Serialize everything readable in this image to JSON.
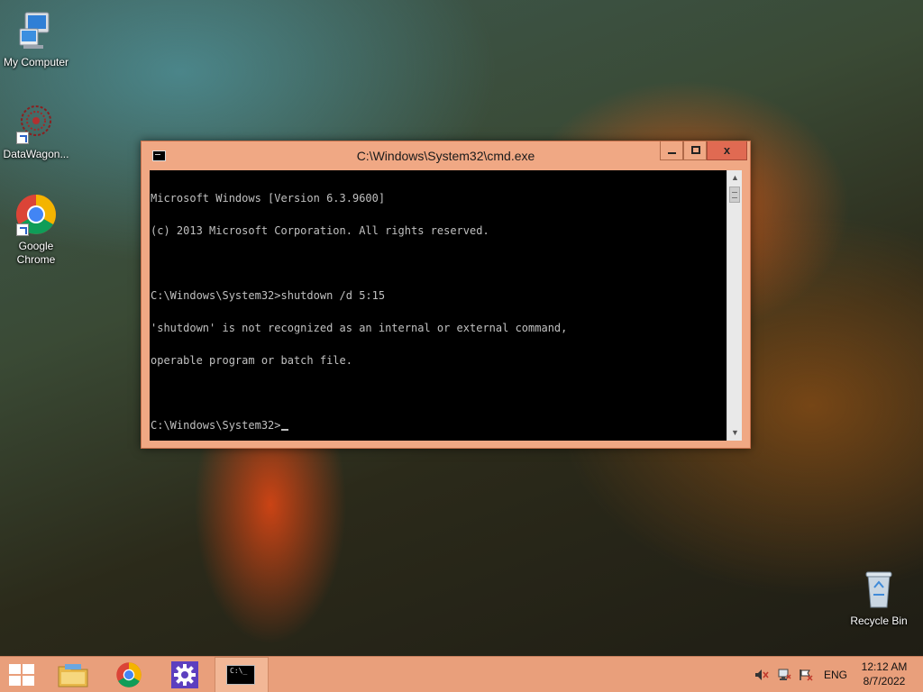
{
  "desktop": {
    "icons": [
      {
        "label": "My Computer"
      },
      {
        "label": "DataWagon..."
      },
      {
        "label": "Google Chrome"
      },
      {
        "label": "Recycle Bin"
      }
    ]
  },
  "window": {
    "title": "C:\\Windows\\System32\\cmd.exe",
    "minimize_glyph": "",
    "maximize_glyph": "",
    "close_glyph": "x",
    "console_lines": [
      "Microsoft Windows [Version 6.3.9600]",
      "(c) 2013 Microsoft Corporation. All rights reserved.",
      "",
      "C:\\Windows\\System32>shutdown /d 5:15",
      "'shutdown' is not recognized as an internal or external command,",
      "operable program or batch file.",
      ""
    ],
    "prompt": "C:\\Windows\\System32>",
    "scroll_up": "▲",
    "scroll_down": "▼"
  },
  "taskbar": {
    "items": [
      "start-icon",
      "file-explorer-icon",
      "chrome-icon",
      "settings-icon",
      "cmd-icon"
    ],
    "active_item": "cmd-icon",
    "cmd_icon_text": "C:\\_",
    "language": "ENG",
    "time": "12:12 AM",
    "date": "8/7/2022"
  },
  "colors": {
    "accent": "#e99f7b",
    "window_frame": "#f0a884",
    "close_button": "#e06a52",
    "console_bg": "#000000",
    "console_fg": "#c0c0c0"
  }
}
